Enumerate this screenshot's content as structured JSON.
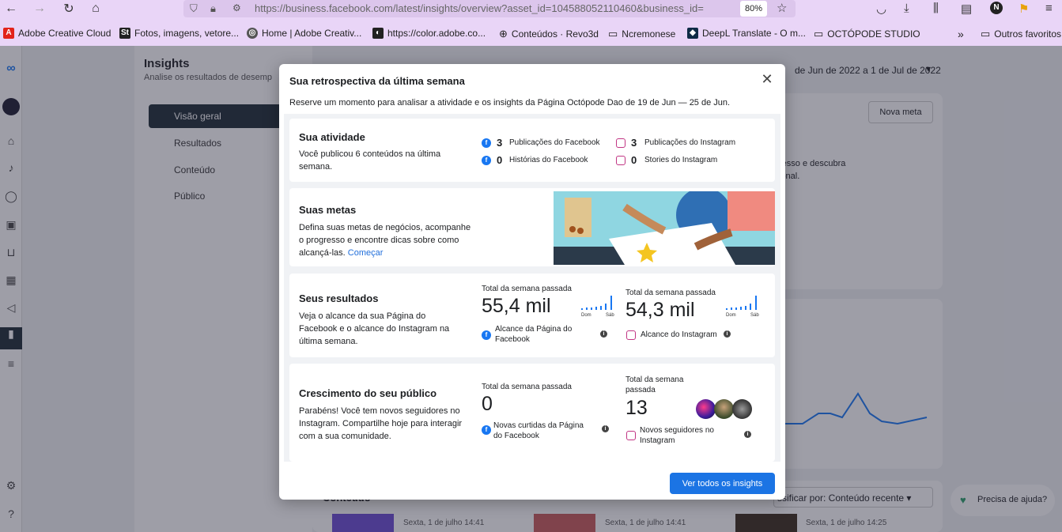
{
  "browser": {
    "url": "https://business.facebook.com/latest/insights/overview?asset_id=104588052110460&business_id=",
    "zoom": "80%",
    "profile_letter": "N",
    "bookmarks": [
      "Adobe Creative Cloud",
      "Fotos, imagens, vetore...",
      "Home | Adobe Creativ...",
      "https://color.adobe.co...",
      "Conteúdos · Revo3d",
      "Ncremonese",
      "DeepL Translate - O m...",
      "OCTÓPODE STUDIO",
      "Outros favoritos"
    ]
  },
  "page": {
    "title": "Insights",
    "subtitle": "Analise os resultados de desemp",
    "date_range": "de Jun de 2022 a 1 de Jul de 2022",
    "new_goal": "Nova meta",
    "bg_text_1": "resso e descubra",
    "bg_text_2": "ional.",
    "sort_label": "ssificar por: Conteúdo recente",
    "content_label": "Conteúdo",
    "help": "Precisa de ajuda?",
    "posts": [
      "Sexta, 1 de julho 14:41",
      "Sexta, 1 de julho 14:41",
      "Sexta, 1 de julho 14:25"
    ],
    "nav": [
      "Visão geral",
      "Resultados",
      "Conteúdo",
      "Público"
    ]
  },
  "modal": {
    "title": "Sua retrospectiva da última semana",
    "close": "✕",
    "subtitle": "Reserve um momento para analisar a atividade e os insights da Página Octópode Dao de 19 de Jun — 25 de Jun.",
    "activity": {
      "title": "Sua atividade",
      "text": "Você publicou 6 conteúdos na última semana.",
      "stats": [
        {
          "num": "3",
          "label": "Publicações do Facebook"
        },
        {
          "num": "3",
          "label": "Publicações do Instagram"
        },
        {
          "num": "0",
          "label": "Histórias do Facebook"
        },
        {
          "num": "0",
          "label": "Stories do Instagram"
        }
      ]
    },
    "goals": {
      "title": "Suas metas",
      "text": "Defina suas metas de negócios, acompanhe o progresso e encontre dicas sobre como alcançá-las.",
      "link": "Começar"
    },
    "results": {
      "title": "Seus resultados",
      "text": "Veja o alcance da sua Página do Facebook e o alcance do Instagram na última semana.",
      "fb_caption": "Total da semana passada",
      "fb_value": "55,4 mil",
      "fb_label": "Alcance da Página do Facebook",
      "ig_caption": "Total da semana passada",
      "ig_value": "54,3 mil",
      "ig_label": "Alcance do Instagram",
      "spark_start": "Dom",
      "spark_end": "Sáb"
    },
    "growth": {
      "title": "Crescimento do seu público",
      "text": "Parabéns! Você tem novos seguidores no Instagram. Compartilhe hoje para interagir com a sua comunidade.",
      "fb_caption": "Total da semana passada",
      "fb_value": "0",
      "fb_label": "Novas curtidas da Página do Facebook",
      "ig_caption": "Total da semana passada",
      "ig_value": "13",
      "ig_label": "Novos seguidores no Instagram"
    },
    "cta": "Ver todos os insights"
  },
  "colors": {
    "accent": "#1b74e4",
    "chrome": "#e9d5f7",
    "link": "#216fdb"
  }
}
